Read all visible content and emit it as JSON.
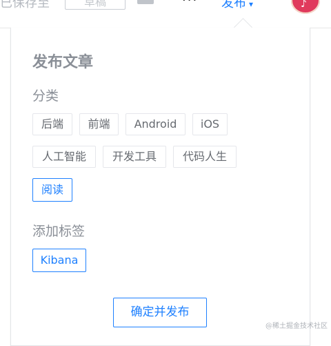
{
  "header": {
    "saved_status": "已保存至",
    "draft_button": "草稿",
    "more_icon": "···",
    "publish_label": "发布",
    "publish_caret": "▾",
    "avatar_glyph": "♪"
  },
  "panel": {
    "title": "发布文章",
    "category_label": "分类",
    "categories": [
      {
        "label": "后端",
        "selected": false
      },
      {
        "label": "前端",
        "selected": false
      },
      {
        "label": "Android",
        "selected": false
      },
      {
        "label": "iOS",
        "selected": false
      },
      {
        "label": "人工智能",
        "selected": false
      },
      {
        "label": "开发工具",
        "selected": false
      },
      {
        "label": "代码人生",
        "selected": false
      },
      {
        "label": "阅读",
        "selected": true
      }
    ],
    "tags_label": "添加标签",
    "tags": [
      {
        "label": "Kibana",
        "selected": true
      }
    ],
    "confirm_button": "确定并发布"
  },
  "watermark": "@稀土掘金技术社区",
  "colors": {
    "accent": "#1e80ff",
    "muted_text": "#8a8f97",
    "tag_border": "#e5e6eb"
  }
}
